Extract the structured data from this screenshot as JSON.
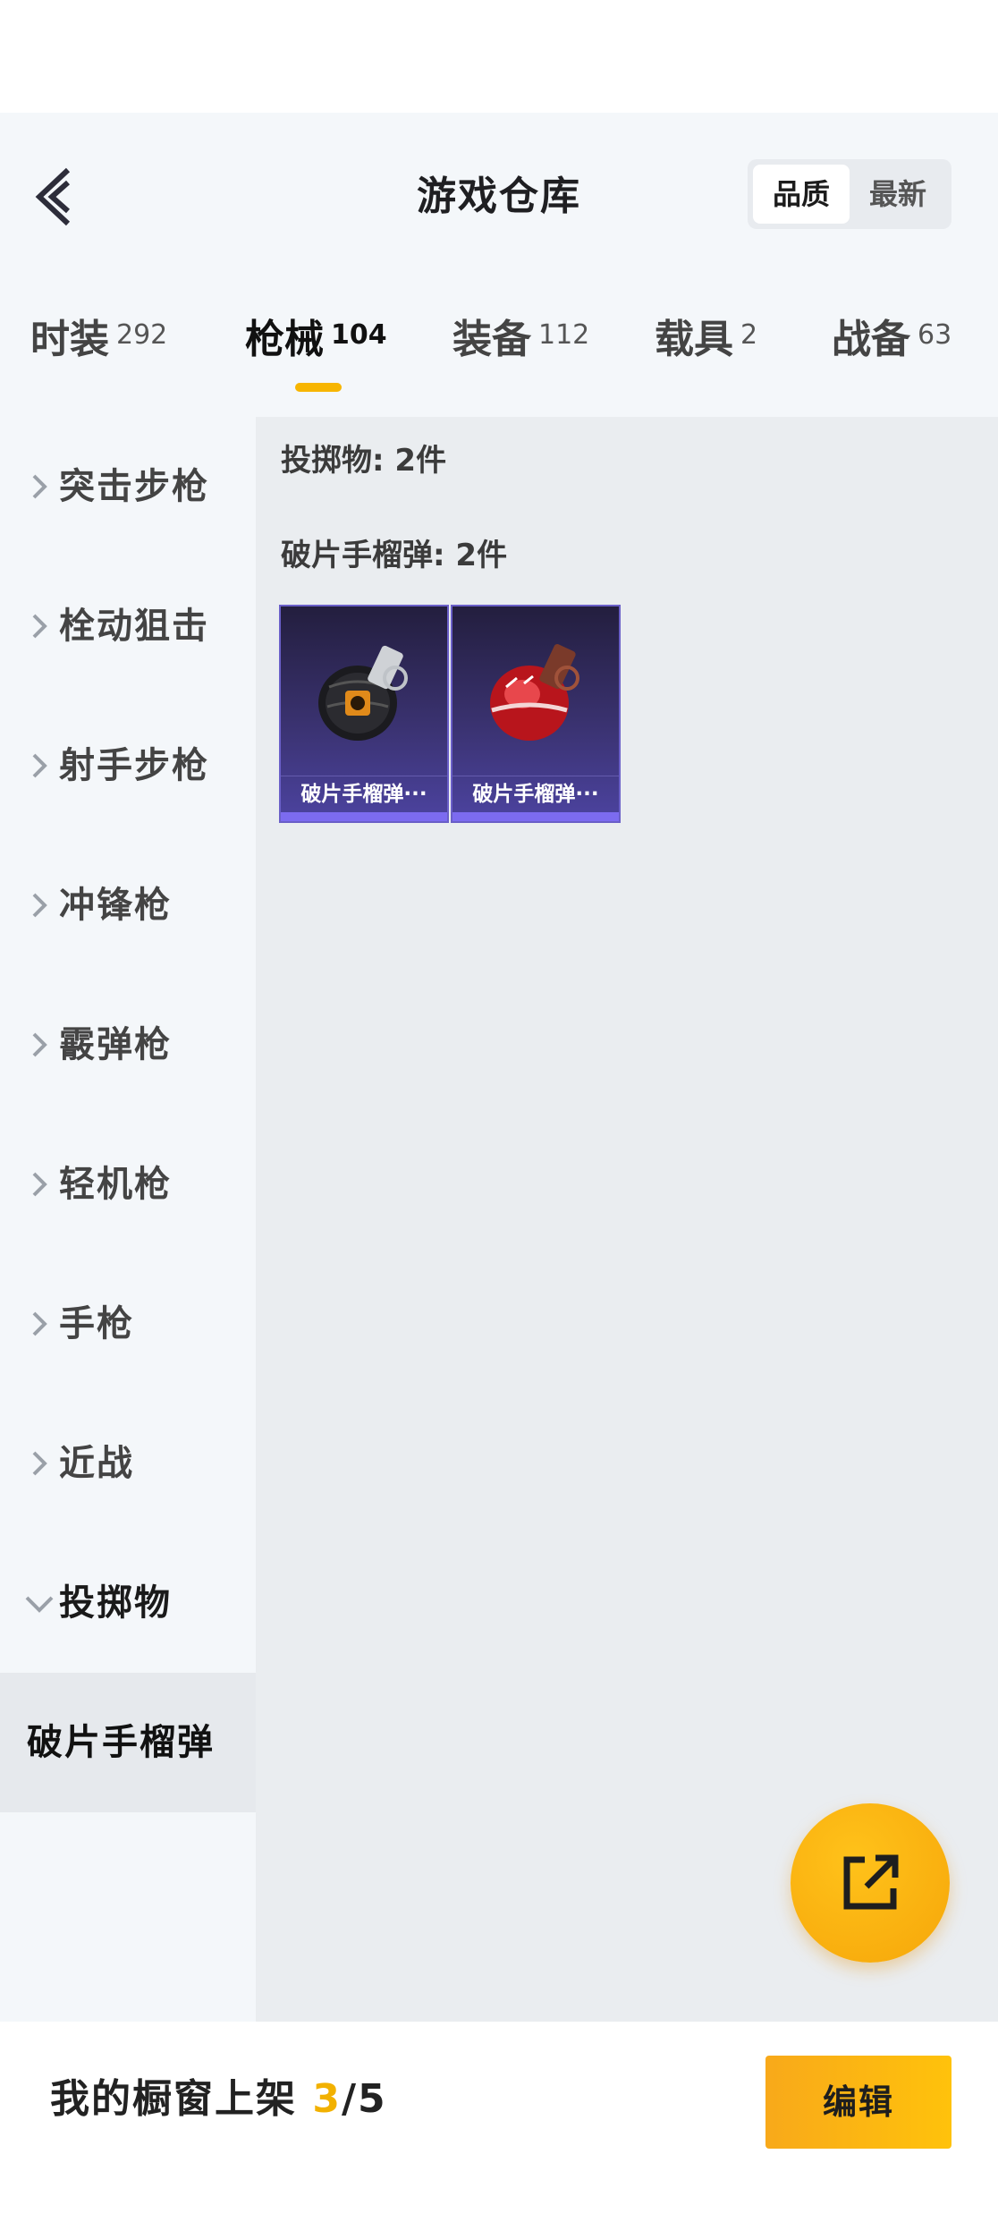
{
  "header": {
    "title": "游戏仓库",
    "sort_options": [
      "品质",
      "最新"
    ]
  },
  "tabs": [
    {
      "label": "时装",
      "count": "292"
    },
    {
      "label": "枪械",
      "count": "104"
    },
    {
      "label": "装备",
      "count": "112"
    },
    {
      "label": "载具",
      "count": "2"
    },
    {
      "label": "战备",
      "count": "63"
    }
  ],
  "sidebar": {
    "items": [
      {
        "label": "突击步枪"
      },
      {
        "label": "栓动狙击"
      },
      {
        "label": "射手步枪"
      },
      {
        "label": "冲锋枪"
      },
      {
        "label": "霰弹枪"
      },
      {
        "label": "轻机枪"
      },
      {
        "label": "手枪"
      },
      {
        "label": "近战"
      },
      {
        "label": "投掷物"
      }
    ],
    "sub_item": "破片手榴弹"
  },
  "content": {
    "category_title": "投掷物: 2件",
    "subcategory_title": "破片手榴弹: 2件",
    "items": [
      {
        "name": "破片手榴弹···",
        "icon": "black-grenade-icon"
      },
      {
        "name": "破片手榴弹···",
        "icon": "red-grenade-icon"
      }
    ]
  },
  "footer": {
    "showcase_label": "我的橱窗上架",
    "showcase_current": "3",
    "showcase_sep_total": "/5",
    "edit_label": "编辑"
  },
  "colors": {
    "accent": "#f7b500",
    "card_bg": "#3a3270"
  }
}
